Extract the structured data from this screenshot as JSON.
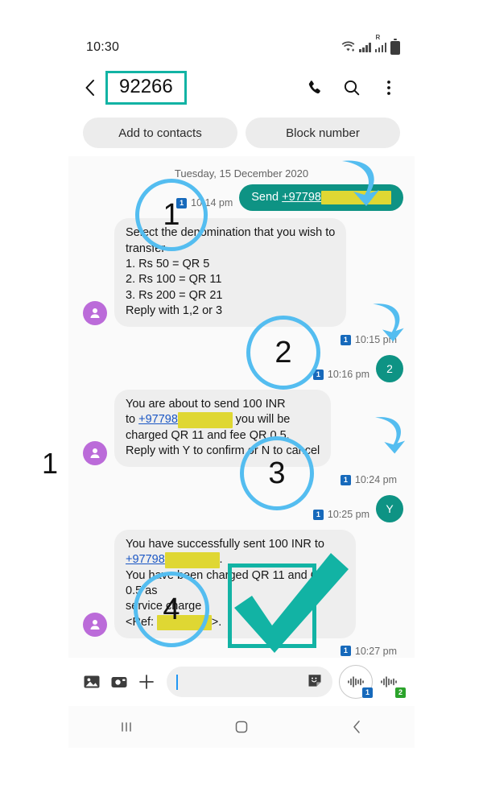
{
  "status_bar": {
    "time": "10:30",
    "icons": [
      "wifi-icon",
      "signal-icon",
      "roaming-signal-icon",
      "battery-icon"
    ],
    "roaming_label": "R"
  },
  "app_bar": {
    "back_icon": "back-chevron-icon",
    "title": "92266",
    "call_icon": "phone-icon",
    "search_icon": "search-icon",
    "overflow_icon": "more-vertical-icon"
  },
  "actions": {
    "add_to_contacts": "Add to contacts",
    "block_number": "Block number"
  },
  "thread": {
    "date_separator": "Tuesday, 15 December 2020",
    "messages": [
      {
        "id": "msg-sent-send-command",
        "direction": "out",
        "type": "bubble",
        "text_prefix": "Send ",
        "link_text": "+97798",
        "redacted": true,
        "time": "10:14 pm",
        "sim": "1"
      },
      {
        "id": "msg-received-denominations",
        "direction": "in",
        "type": "bubble",
        "lines": [
          "Select the denomination that you wish to",
          "transfer",
          "1. Rs 50 = QR 5",
          "2. Rs 100 = QR 11",
          "3. Rs 200 = QR 21",
          "Reply with 1,2 or 3"
        ],
        "time": "10:15 pm",
        "sim": "1"
      },
      {
        "id": "msg-sent-option-two",
        "direction": "out",
        "type": "mini",
        "text": "2",
        "time": "10:16 pm",
        "sim": "1"
      },
      {
        "id": "msg-received-confirm-prompt",
        "direction": "in",
        "type": "bubble",
        "lines": [
          "You are about to send 100 INR",
          "to +97798████ you will be",
          "charged QR 11 and fee QR 0.5.",
          "Reply with Y to confirm or N to cancel"
        ],
        "time": "10:24 pm",
        "sim": "1"
      },
      {
        "id": "msg-sent-confirm-yes",
        "direction": "out",
        "type": "mini",
        "text": "Y",
        "time": "10:25 pm",
        "sim": "1"
      },
      {
        "id": "msg-received-success",
        "direction": "in",
        "type": "bubble",
        "lines": [
          "You have successfully sent 100 INR to",
          "+97798████.",
          "You have been charged QR 11 and QR 0.5 as",
          "service charge",
          "<Ref: ████>."
        ],
        "time": "10:27 pm",
        "sim": "1"
      }
    ]
  },
  "composer": {
    "gallery_icon": "image-icon",
    "camera_icon": "camera-icon",
    "add_icon": "plus-icon",
    "input_value": "",
    "input_placeholder": "",
    "sticker_icon": "sticker-icon",
    "voice_sim1_icon": "voice-waveform-icon",
    "voice_sim1_badge": "1",
    "voice_sim2_icon": "voice-waveform-icon",
    "voice_sim2_badge": "2"
  },
  "nav_bar": {
    "recents_icon": "recents-icon",
    "home_icon": "home-icon",
    "back_icon": "back-icon"
  },
  "annotations": {
    "step_1": "1",
    "step_2": "2",
    "step_3": "3",
    "step_4": "4",
    "margin_number": "1",
    "checkmark_icon": "check-mark-icon",
    "arrow_icon": "curved-arrow-icon",
    "circle_color": "#54bdf0",
    "highlight_color": "#12b3a4"
  },
  "colors": {
    "sent_bubble": "#0e9384",
    "received_bubble": "#eeeeee",
    "avatar": "#bb6bd9",
    "redaction": "#dfd733",
    "sim_badge_1": "#1669bb",
    "sim_badge_2": "#2ba32b",
    "thread_background": "#fafafa"
  }
}
